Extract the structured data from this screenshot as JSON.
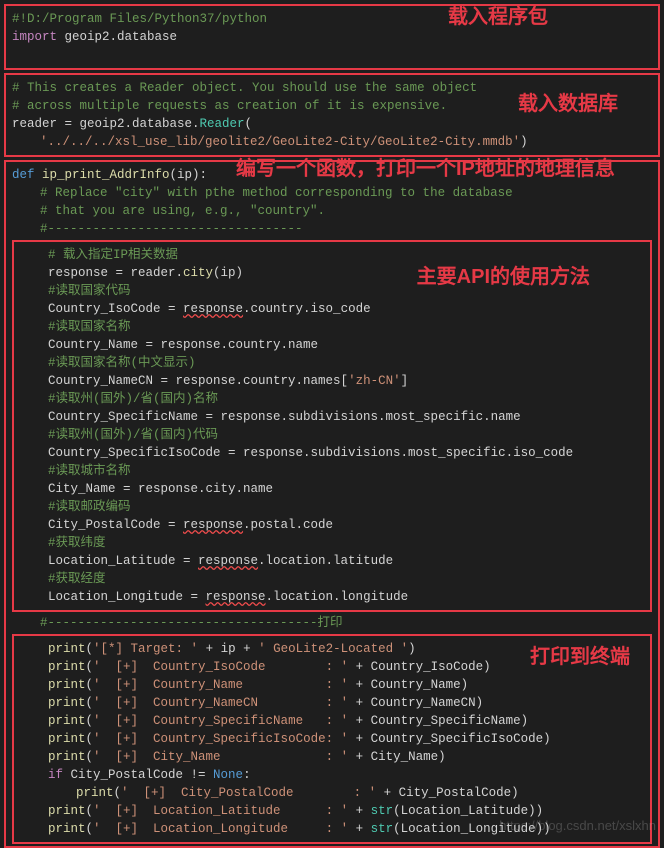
{
  "annotations": {
    "a1": "载入程序包",
    "a2": "载入数据库",
    "a3": "编写一个函数，打印一个IP地址的地理信息",
    "a4": "主要API的使用方法",
    "a5": "打印到终端"
  },
  "block1": {
    "l1": "#!D:/Program Files/Python37/python",
    "l2_kw": "import",
    "l2_mod": " geoip2.database"
  },
  "block2": {
    "l1": "# This creates a Reader object. You should use the same object",
    "l2": "# across multiple requests as creation of it is expensive.",
    "l3_var": "reader = geoip2.database.",
    "l3_cls": "Reader",
    "l3_p": "(",
    "l4_str": "'../../../xsl_use_lib/geolite2/GeoLite2-City/GeoLite2-City.mmdb'",
    "l4_p": ")"
  },
  "block3": {
    "def": "def",
    "fname": " ip_print_AddrInfo",
    "sig": "(ip):",
    "c1": "# Replace \"city\" with pthe method corresponding to the database",
    "c2": "# that you are using, e.g., \"country\".",
    "c3": "#----------------------------------",
    "cc1": "# 载入指定IP相关数据",
    "l_resp": "response = reader.",
    "l_resp_m": "city",
    "l_resp_e": "(ip)",
    "cc2": "#读取国家代码",
    "l_ciso": "Country_IsoCode = ",
    "l_ciso_r": "response",
    "l_ciso_e": ".country.iso_code",
    "cc3": "#读取国家名称",
    "l_cname": "Country_Name = response.country.name",
    "cc4": "#读取国家名称(中文显示)",
    "l_cncn": "Country_NameCN = response.country.names[",
    "l_cncn_s": "'zh-CN'",
    "l_cncn_e": "]",
    "cc5": "#读取州(国外)/省(国内)名称",
    "l_spn": "Country_SpecificName = response.subdivisions.most_specific.name",
    "cc6": "#读取州(国外)/省(国内)代码",
    "l_spi": "Country_SpecificIsoCode = response.subdivisions.most_specific.iso_code",
    "cc7": "#读取城市名称",
    "l_city": "City_Name = response.city.name",
    "cc8": "#读取邮政编码",
    "l_pc": "City_PostalCode = ",
    "l_pc_r": "response",
    "l_pc_e": ".postal.code",
    "cc9": "#获取纬度",
    "l_lat": "Location_Latitude = ",
    "l_lat_r": "response",
    "l_lat_e": ".location.latitude",
    "cc10": "#获取经度",
    "l_lon": "Location_Longitude = ",
    "l_lon_r": "response",
    "l_lon_e": ".location.longitude",
    "cprint": "#------------------------------------打印",
    "p1a": "print",
    "p1b": "(",
    "p1s": "'[*] Target: '",
    "p1p": " + ip + ",
    "p1s2": "' GeoLite2-Located '",
    "p1e": ")",
    "p2s": "'  [+]  Country_IsoCode        : '",
    "p2v": " + Country_IsoCode)",
    "p3s": "'  [+]  Country_Name           : '",
    "p3v": " + Country_Name)",
    "p4s": "'  [+]  Country_NameCN         : '",
    "p4v": " + Country_NameCN)",
    "p5s": "'  [+]  Country_SpecificName   : '",
    "p5v": " + Country_SpecificName)",
    "p6s": "'  [+]  Country_SpecificIsoCode: '",
    "p6v": " + Country_SpecificIsoCode)",
    "p7s": "'  [+]  City_Name              : '",
    "p7v": " + City_Name)",
    "if_kw": "if",
    "if_cond": " City_PostalCode != ",
    "none": "None",
    "if_e": ":",
    "p8s": "'  [+]  City_PostalCode        : '",
    "p8v": " + City_PostalCode)",
    "p9s": "'  [+]  Location_Latitude      : '",
    "p9v": " + ",
    "str_fn": "str",
    "p9v2": "(Location_Latitude))",
    "p10s": "'  [+]  Location_Longitude     : '",
    "p10v2": "(Location_Longitude))"
  },
  "watermark": "https://blog.csdn.net/xslxhn"
}
